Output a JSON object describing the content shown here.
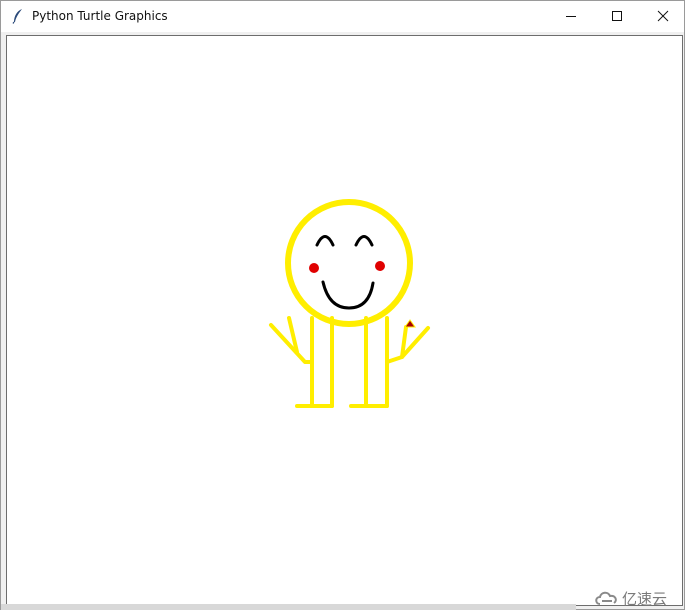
{
  "window": {
    "title": "Python Turtle Graphics",
    "icon": "feather-icon",
    "controls": [
      "minimize-icon",
      "maximize-icon",
      "close-icon"
    ]
  },
  "canvas": {
    "background": "#ffffff",
    "drawing": {
      "description_icons": [
        "smiley-face",
        "stick-figure"
      ],
      "colors": {
        "body": "#ffee00",
        "face_features": "#000000",
        "cheeks": "#e00000",
        "turtle_cursor": "#aa0000"
      }
    }
  },
  "watermark": {
    "logo": "cloud-logo-icon",
    "text": "亿速云"
  }
}
